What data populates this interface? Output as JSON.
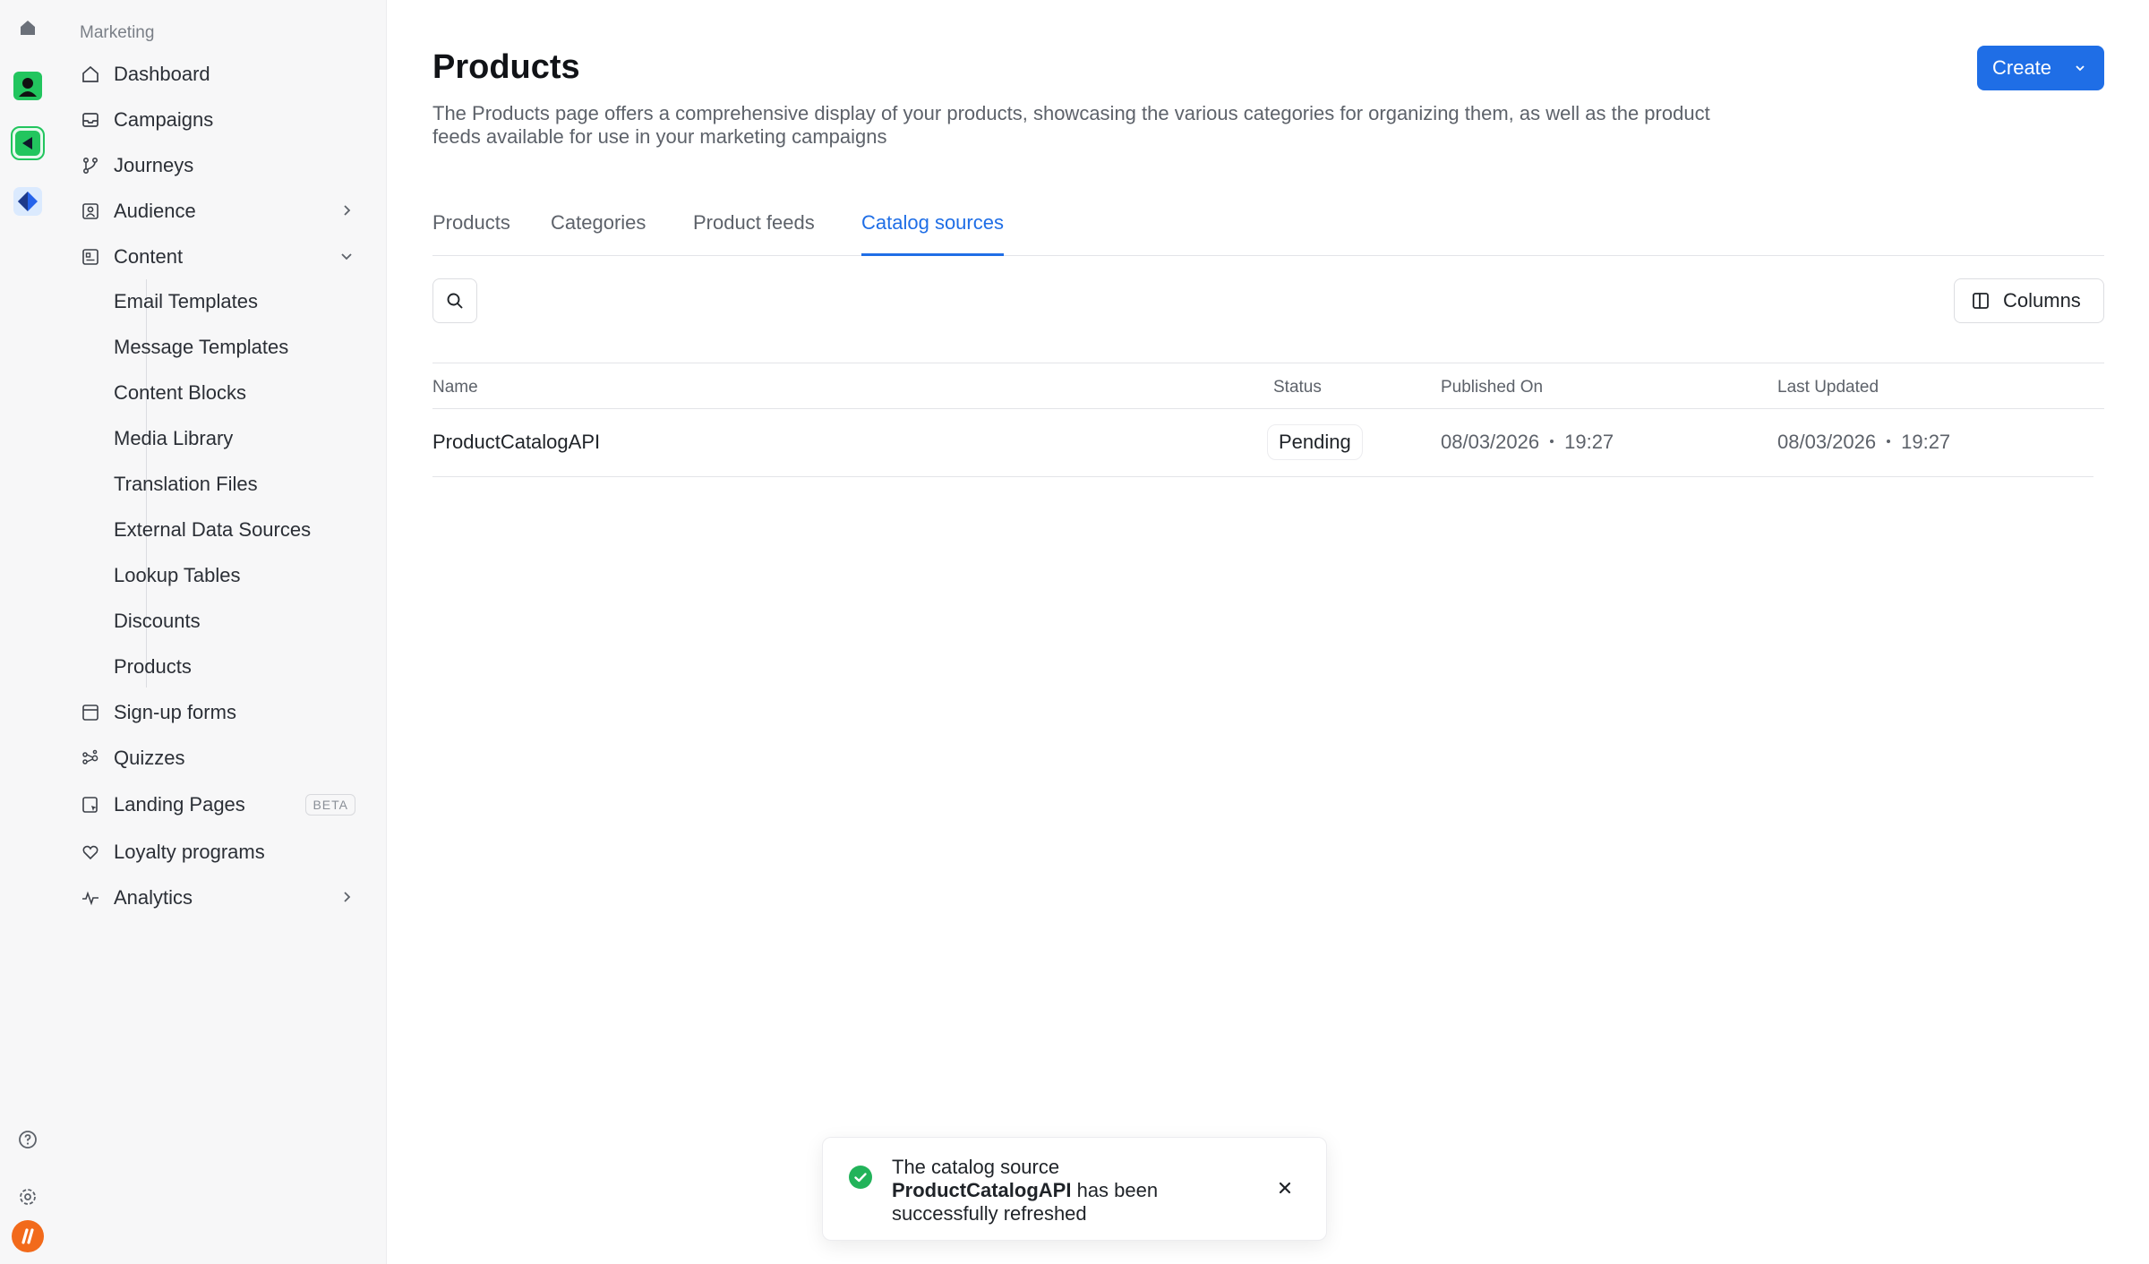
{
  "rail": {
    "icons": [
      "home-icon",
      "app-green-icon",
      "app-active-icon",
      "app-blue-icon",
      "help-icon",
      "settings-icon",
      "brand-logo-icon"
    ]
  },
  "sidebar": {
    "section_label": "Marketing",
    "items": [
      {
        "label": "Dashboard",
        "icon": "home-outline-icon"
      },
      {
        "label": "Campaigns",
        "icon": "inbox-icon"
      },
      {
        "label": "Journeys",
        "icon": "branch-icon"
      },
      {
        "label": "Audience",
        "icon": "audience-icon"
      },
      {
        "label": "Content",
        "icon": "content-icon"
      },
      {
        "label": "Sign-up forms",
        "icon": "form-icon"
      },
      {
        "label": "Quizzes",
        "icon": "quiz-icon"
      },
      {
        "label": "Landing Pages",
        "icon": "landing-icon",
        "badge": "BETA"
      },
      {
        "label": "Loyalty programs",
        "icon": "heart-icon"
      },
      {
        "label": "Analytics",
        "icon": "pulse-icon"
      }
    ],
    "content_children": [
      "Email Templates",
      "Message Templates",
      "Content Blocks",
      "Media Library",
      "Translation Files",
      "External Data Sources",
      "Lookup Tables",
      "Discounts",
      "Products"
    ]
  },
  "header": {
    "title": "Products",
    "description": "The Products page offers a comprehensive display of your products, showcasing the various categories for organizing them, as well as the product feeds available for use in your marketing campaigns",
    "create_label": "Create"
  },
  "tabs": [
    {
      "label": "Products",
      "active": false
    },
    {
      "label": "Categories",
      "active": false
    },
    {
      "label": "Product feeds",
      "active": false
    },
    {
      "label": "Catalog sources",
      "active": true
    }
  ],
  "toolbar": {
    "columns_label": "Columns"
  },
  "table": {
    "columns": [
      "Name",
      "Status",
      "Published On",
      "Last Updated"
    ],
    "rows": [
      {
        "name": "ProductCatalogAPI",
        "status": "Pending",
        "published_date": "08/03/2026",
        "published_time": "19:27",
        "updated_date": "08/03/2026",
        "updated_time": "19:27"
      }
    ]
  },
  "toast": {
    "line1": "The catalog source",
    "source_name": "ProductCatalogAPI",
    "line2_suffix": " has been",
    "line3": "successfully refreshed"
  },
  "colors": {
    "accent": "#1f6ee6",
    "success": "#22b35a",
    "brand_orange": "#f26a1b"
  }
}
